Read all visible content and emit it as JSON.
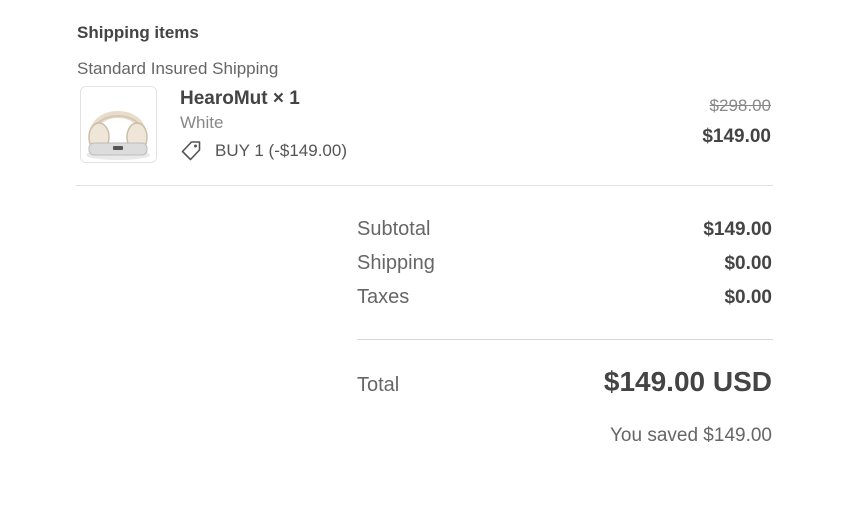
{
  "section": {
    "title": "Shipping items"
  },
  "shipping_method": "Standard Insured Shipping",
  "item": {
    "image_icon": "headphones-product-image",
    "name": "HearoMut × 1",
    "variant": "White",
    "discount_icon": "tag-icon",
    "discount_label": "BUY 1 (-$149.00)",
    "original_price": "$298.00",
    "price": "$149.00"
  },
  "summary": {
    "subtotal_label": "Subtotal",
    "subtotal_value": "$149.00",
    "shipping_label": "Shipping",
    "shipping_value": "$0.00",
    "taxes_label": "Taxes",
    "taxes_value": "$0.00",
    "total_label": "Total",
    "total_value": "$149.00 USD",
    "saved_text": "You saved $149.00"
  }
}
